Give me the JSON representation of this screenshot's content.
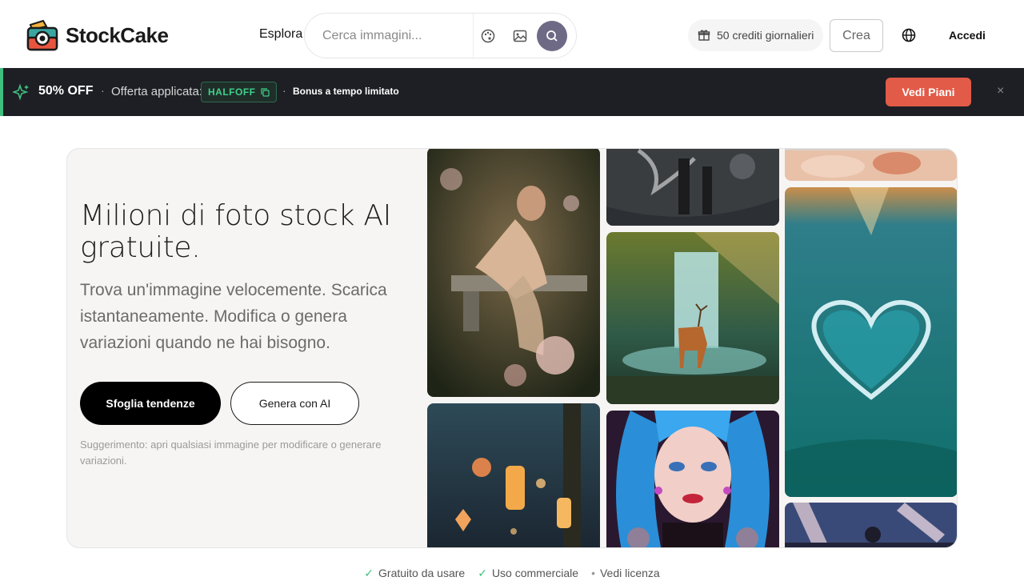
{
  "brand": {
    "name": "StockCake"
  },
  "header": {
    "explore_label": "Esplora",
    "search_placeholder": "Cerca immagini...",
    "credits_label": "50 crediti giornalieri",
    "create_label": "Crea",
    "login_label": "Accedi"
  },
  "promo": {
    "discount": "50% OFF",
    "applied_label": "Offerta applicata:",
    "code": "HALFOFF",
    "bonus": "Bonus a tempo limitato",
    "plans_button": "Vedi Piani",
    "close": "×",
    "accent_color": "#3fbf7f",
    "button_color": "#e25b48"
  },
  "hero": {
    "title": "Milioni di foto stock AI gratuite.",
    "subtitle": "Trova un'immagine velocemente. Scarica istantaneamente. Modifica o genera variazioni quando ne hai bisogno.",
    "primary_button": "Sfoglia tendenze",
    "secondary_button": "Genera con AI",
    "hint": "Suggerimento: apri qualsiasi immagine per modificare o generare variazioni."
  },
  "gallery": [
    {
      "subject": "woman sitting on bench in garden"
    },
    {
      "subject": "glowing lanterns in forest"
    },
    {
      "subject": "dark fantasy creature"
    },
    {
      "subject": "deer by waterfall"
    },
    {
      "subject": "blue haired woman portrait"
    },
    {
      "subject": "heart shaped wave in ocean"
    },
    {
      "subject": "concert crowd with lights"
    }
  ],
  "features": [
    {
      "label": "Gratuito da usare",
      "icon": "check-icon"
    },
    {
      "label": "Uso commerciale",
      "icon": "check-icon"
    },
    {
      "label": "Vedi licenza",
      "icon": "dot-icon"
    }
  ]
}
